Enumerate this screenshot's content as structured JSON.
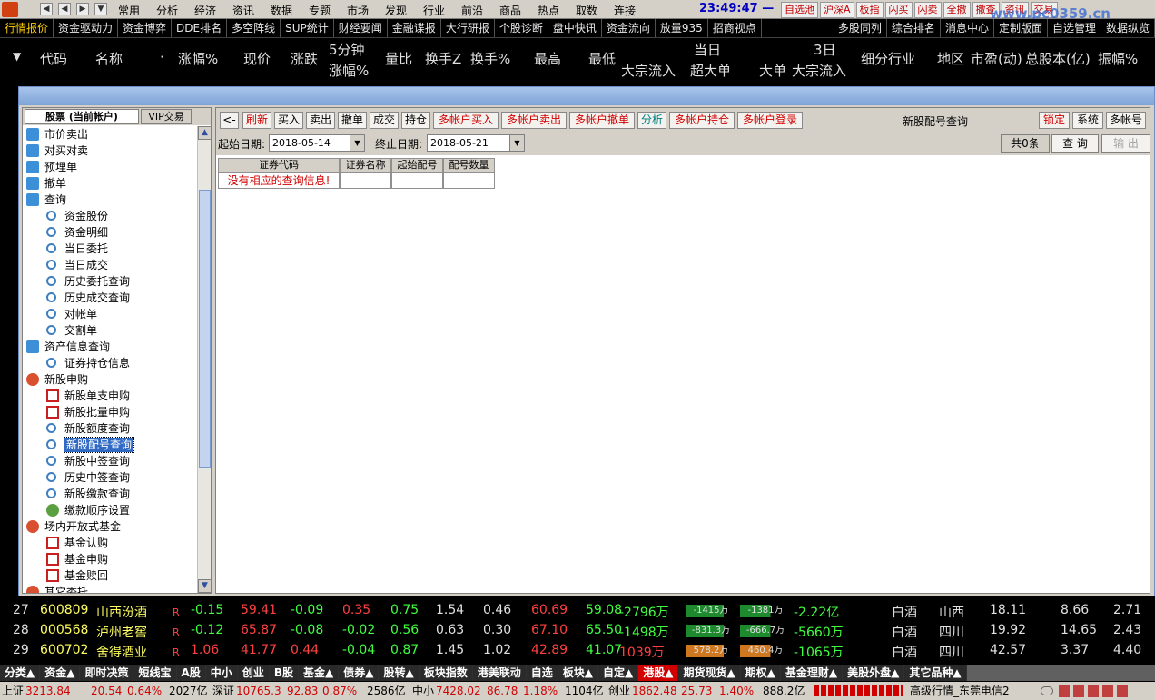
{
  "menu": {
    "items": [
      "常用",
      "分析",
      "经济",
      "资讯",
      "数据",
      "专题",
      "市场",
      "发现",
      "行业",
      "前沿",
      "商品",
      "热点",
      "取数",
      "连接"
    ],
    "clock": "23:49:47 —",
    "right_buttons": [
      "自选池",
      "沪深A",
      "板指",
      "闪买",
      "闪卖",
      "全撤",
      "撤查",
      "资讯",
      "交易"
    ],
    "watermark": "www.pc0359.cn"
  },
  "tabbar": {
    "items": [
      "行情报价",
      "资金驱动力",
      "资金博弈",
      "DDE排名",
      "多空阵线",
      "SUP统计",
      "财经要闻",
      "金融谍报",
      "大行研报",
      "个股诊断",
      "盘中快讯",
      "资金流向",
      "放量935",
      "招商视点",
      "多股同列",
      "综合排名",
      "消息中心",
      "定制版面",
      "自选管理",
      "数据纵览"
    ]
  },
  "header": {
    "cols": [
      "代码",
      "名称",
      "·",
      "涨幅%",
      "现价",
      "涨跌",
      "5分钟",
      "涨幅%",
      "量比",
      "换手Z",
      "换手%",
      "最高",
      "最低",
      "当日",
      "大宗流入",
      "超大单",
      "大单",
      "3日",
      "大宗流入",
      "细分行业",
      "地区",
      "市盈(动)",
      "总股本(亿)",
      "振幅%"
    ]
  },
  "tree": {
    "tab1": "股票 (当前帐户)",
    "tab2": "VIP交易",
    "items": [
      {
        "label": "市价卖出",
        "icon": "blue",
        "lvl": 0
      },
      {
        "label": "对买对卖",
        "icon": "blue",
        "lvl": 0
      },
      {
        "label": "预埋单",
        "icon": "blue",
        "lvl": 0
      },
      {
        "label": "撤单",
        "icon": "blue",
        "lvl": 0
      },
      {
        "label": "查询",
        "icon": "blue",
        "lvl": 0
      },
      {
        "label": "资金股份",
        "icon": "mag",
        "lvl": 1
      },
      {
        "label": "资金明细",
        "icon": "mag",
        "lvl": 1
      },
      {
        "label": "当日委托",
        "icon": "mag",
        "lvl": 1
      },
      {
        "label": "当日成交",
        "icon": "mag",
        "lvl": 1
      },
      {
        "label": "历史委托查询",
        "icon": "mag",
        "lvl": 1
      },
      {
        "label": "历史成交查询",
        "icon": "mag",
        "lvl": 1
      },
      {
        "label": "对帐单",
        "icon": "mag",
        "lvl": 1
      },
      {
        "label": "交割单",
        "icon": "mag",
        "lvl": 1
      },
      {
        "label": "资产信息查询",
        "icon": "blue",
        "lvl": 0
      },
      {
        "label": "证券持仓信息",
        "icon": "mag",
        "lvl": 1
      },
      {
        "label": "新股申购",
        "icon": "hand",
        "lvl": 0
      },
      {
        "label": "新股单支申购",
        "icon": "red",
        "lvl": 1
      },
      {
        "label": "新股批量申购",
        "icon": "red",
        "lvl": 1
      },
      {
        "label": "新股额度查询",
        "icon": "mag",
        "lvl": 1
      },
      {
        "label": "新股配号查询",
        "icon": "mag",
        "lvl": 1,
        "sel": true
      },
      {
        "label": "新股中签查询",
        "icon": "mag",
        "lvl": 1
      },
      {
        "label": "历史中签查询",
        "icon": "mag",
        "lvl": 1
      },
      {
        "label": "新股缴款查询",
        "icon": "mag",
        "lvl": 1
      },
      {
        "label": "缴款顺序设置",
        "icon": "gear",
        "lvl": 1
      },
      {
        "label": "场内开放式基金",
        "icon": "hand",
        "lvl": 0
      },
      {
        "label": "基金认购",
        "icon": "red",
        "lvl": 1
      },
      {
        "label": "基金申购",
        "icon": "red",
        "lvl": 1
      },
      {
        "label": "基金赎回",
        "icon": "red",
        "lvl": 1
      },
      {
        "label": "其它委托",
        "icon": "hand",
        "lvl": 0
      }
    ]
  },
  "toolbar": {
    "back": "<-",
    "buttons": [
      {
        "t": "刷新",
        "c": "red"
      },
      {
        "t": "买入",
        "c": "blk"
      },
      {
        "t": "卖出",
        "c": "blk"
      },
      {
        "t": "撤单",
        "c": "blk"
      },
      {
        "t": "成交",
        "c": "blk"
      },
      {
        "t": "持仓",
        "c": "blk"
      },
      {
        "t": "多帐户买入",
        "c": "red"
      },
      {
        "t": "多帐户卖出",
        "c": "red"
      },
      {
        "t": "多帐户撤单",
        "c": "red"
      },
      {
        "t": "分析",
        "c": "teal"
      },
      {
        "t": "多帐户持仓",
        "c": "red"
      },
      {
        "t": "多帐户登录",
        "c": "red"
      }
    ],
    "title": "新股配号查询",
    "right": [
      {
        "t": "锁定",
        "c": "red"
      },
      {
        "t": "系统",
        "c": "blk"
      },
      {
        "t": "多帐号",
        "c": "blk"
      }
    ]
  },
  "filter": {
    "start_label": "起始日期:",
    "start": "2018-05-14",
    "end_label": "终止日期:",
    "end": "2018-05-21",
    "count": "共0条",
    "query": "查 询",
    "export": "输 出"
  },
  "grid": {
    "cols": [
      "证券代码",
      "证券名称",
      "起始配号",
      "配号数量"
    ],
    "empty": "没有相应的查询信息!"
  },
  "rows": [
    {
      "n": "27",
      "code": "600809",
      "name": "山西汾酒",
      "r": "R",
      "chg": "-0.15",
      "price": "59.41",
      "diff": "-0.09",
      "m5": "0.35",
      "vr": "0.75",
      "tz": "1.54",
      "tp": "0.46",
      "hi": "60.69",
      "lo": "59.08",
      "dz": "-2796万",
      "b1": "-1415万",
      "b2": "-1381万",
      "dd": "-2.22亿",
      "ind": "白酒",
      "reg": "山西",
      "pe": "18.11",
      "cap": "8.66",
      "amp": "2.71",
      "bc": "green"
    },
    {
      "n": "28",
      "code": "000568",
      "name": "泸州老窖",
      "r": "R",
      "chg": "-0.12",
      "price": "65.87",
      "diff": "-0.08",
      "m5": "-0.02",
      "vr": "0.56",
      "tz": "0.63",
      "tp": "0.30",
      "hi": "67.10",
      "lo": "65.50",
      "dz": "-1498万",
      "b1": "-831.3万",
      "b2": "-666.7万",
      "dd": "-5660万",
      "ind": "白酒",
      "reg": "四川",
      "pe": "19.92",
      "cap": "14.65",
      "amp": "2.43",
      "bc": "green"
    },
    {
      "n": "29",
      "code": "600702",
      "name": "舍得酒业",
      "r": "R",
      "chg": "1.06",
      "price": "41.77",
      "diff": "0.44",
      "m5": "-0.04",
      "vr": "0.87",
      "tz": "1.45",
      "tp": "1.02",
      "hi": "42.89",
      "lo": "41.07",
      "dz": "1039万",
      "b1": "578.2万",
      "b2": "460.4万",
      "dd": "-1065万",
      "ind": "白酒",
      "reg": "四川",
      "pe": "42.57",
      "cap": "3.37",
      "amp": "4.40",
      "bc": "orange"
    }
  ],
  "bottom_tabs": [
    "分类▲",
    "资金▲",
    "即时决策",
    "短线宝",
    "A股",
    "中小",
    "创业",
    "B股",
    "基金▲",
    "债券▲",
    "股转▲",
    "板块指数",
    "港美联动",
    "自选",
    "板块▲",
    "自定▲",
    "港股▲",
    "期货现货▲",
    "期权▲",
    "基金理财▲",
    "美股外盘▲",
    "其它品种▲"
  ],
  "status": {
    "sh": "上证",
    "sh_v": "3213.84",
    "sh_c": "20.54",
    "sh_p": "0.64%",
    "sh_a": "2027亿",
    "sz": "深证",
    "sz_v": "10765.3",
    "sz_c": "92.83",
    "sz_p": "0.87%",
    "sz_a": "2586亿",
    "zx": "中小",
    "zx_v": "7428.02",
    "zx_c": "86.78",
    "zx_p": "1.18%",
    "zx_a": "1104亿",
    "cy": "创业",
    "cy_v": "1862.48",
    "cy_c": "25.73",
    "cy_p": "1.40%",
    "cy_a": "888.2亿",
    "feed": "高级行情_东莞电信2"
  }
}
